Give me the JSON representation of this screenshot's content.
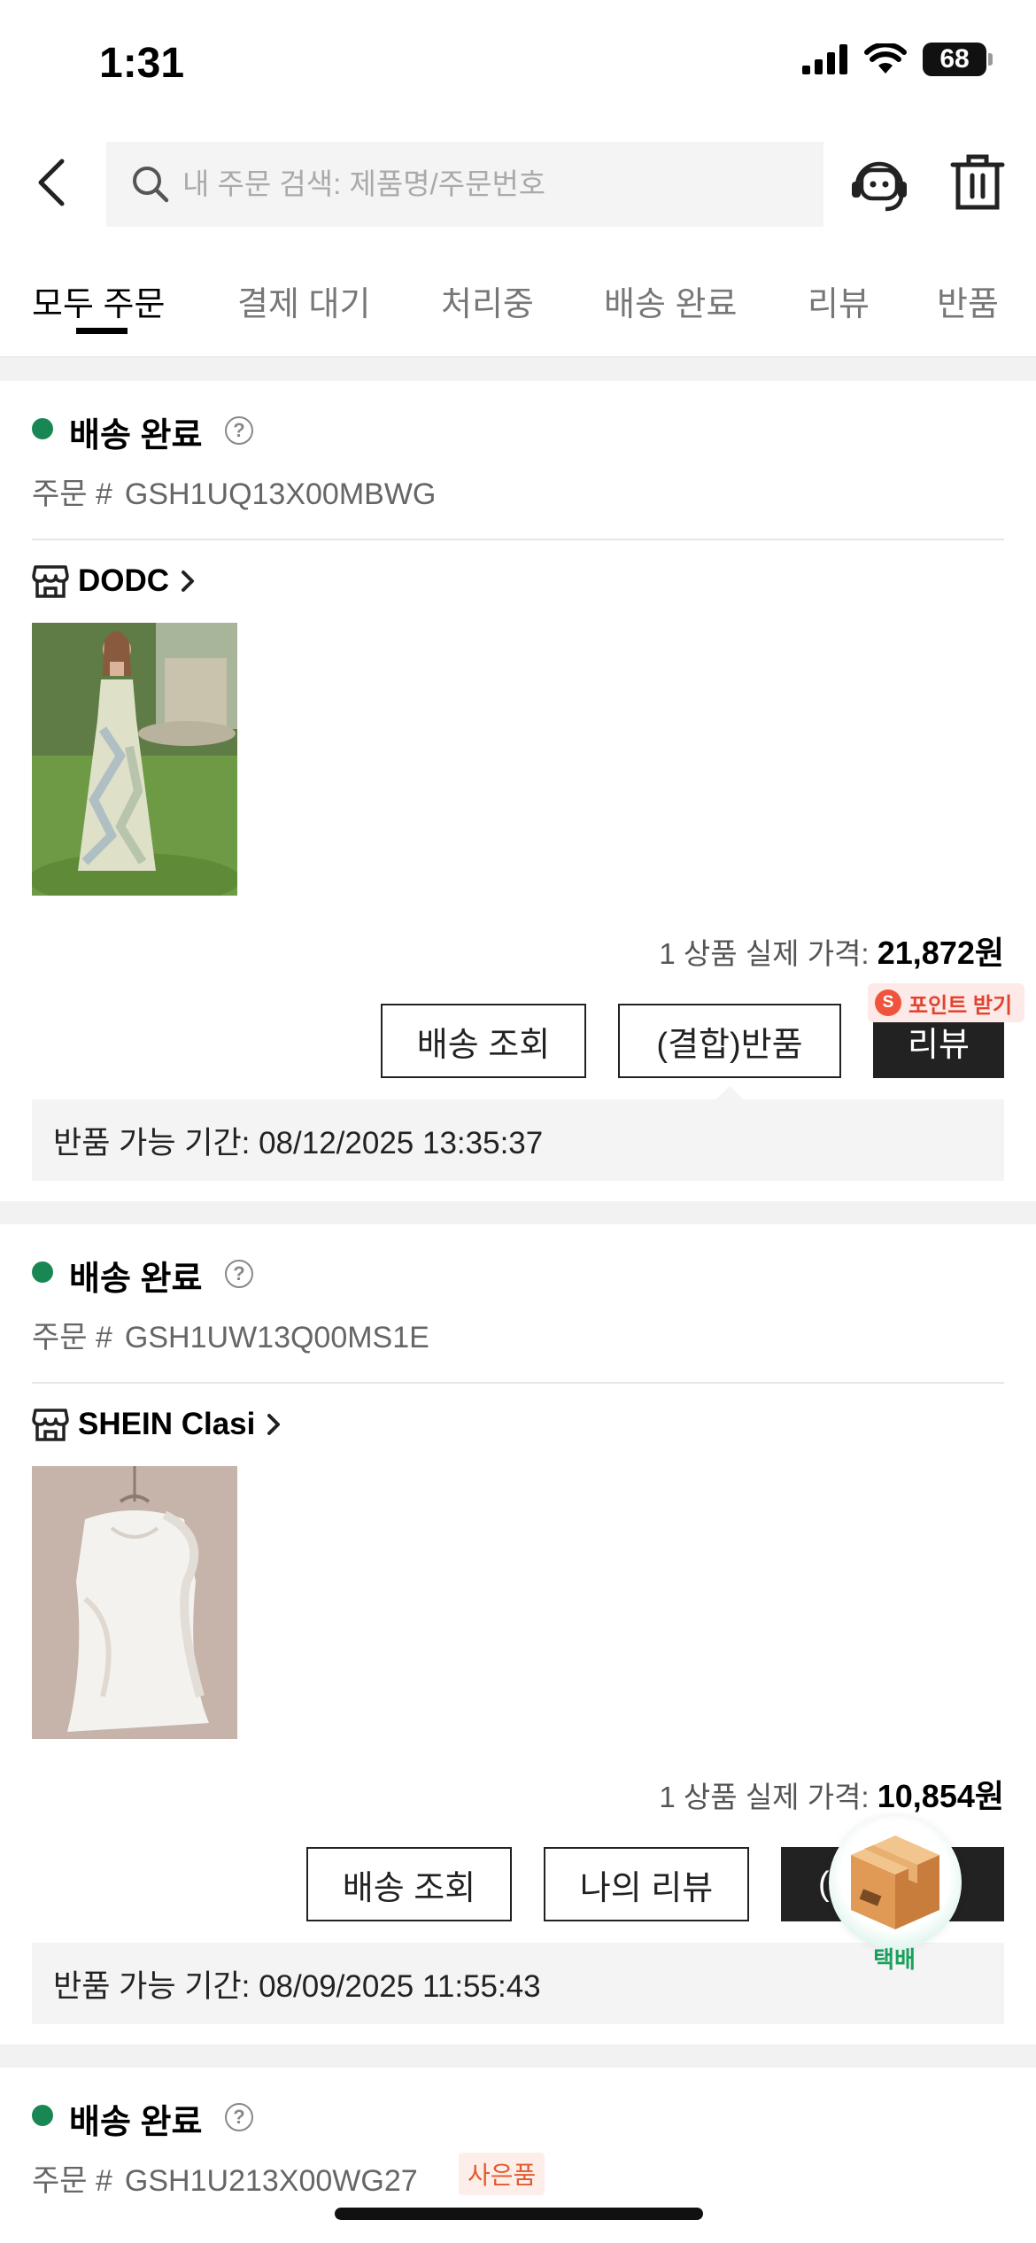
{
  "status_bar": {
    "time": "1:31",
    "battery": "68"
  },
  "header": {
    "search_placeholder": "내 주문 검색: 제품명/주문번호",
    "icons": [
      "back-arrow-icon",
      "search-icon",
      "customer-service-icon",
      "trash-icon"
    ]
  },
  "tabs": [
    {
      "label": "모두 주문",
      "active": true
    },
    {
      "label": "결제 대기",
      "active": false
    },
    {
      "label": "처리중",
      "active": false
    },
    {
      "label": "배송 완료",
      "active": false
    },
    {
      "label": "리뷰",
      "active": false
    },
    {
      "label": "반품",
      "active": false
    }
  ],
  "orders": [
    {
      "status": "배송 완료",
      "order_prefix": "주문 #",
      "order_number": "GSH1UQ13X00MBWG",
      "store": "DODC",
      "price_label": "1 상품 실제 가격:",
      "price": "21,872원",
      "buttons": [
        "배송 조회",
        "(결합)반품",
        "리뷰"
      ],
      "badge": {
        "letter": "S",
        "text": "포인트 받기"
      },
      "return_period": "반품 가능 기간: 08/12/2025 13:35:37"
    },
    {
      "status": "배송 완료",
      "order_prefix": "주문 #",
      "order_number": "GSH1UW13Q00MS1E",
      "store": "SHEIN Clasi",
      "price_label": "1 상품 실제 가격:",
      "price": "10,854원",
      "buttons": [
        "배송 조회",
        "나의 리뷰",
        "("
      ],
      "return_period": "반품 가능 기간: 08/09/2025 11:55:43"
    },
    {
      "status": "배송 완료",
      "order_prefix": "주문 #",
      "order_number": "GSH1U213X00WG27",
      "tag": "사은품"
    }
  ],
  "floating": {
    "label": "택배"
  },
  "colors": {
    "status_green": "#198754",
    "accent_red": "#e0432f",
    "float_green": "#18a05c",
    "button_dark": "#222222"
  }
}
